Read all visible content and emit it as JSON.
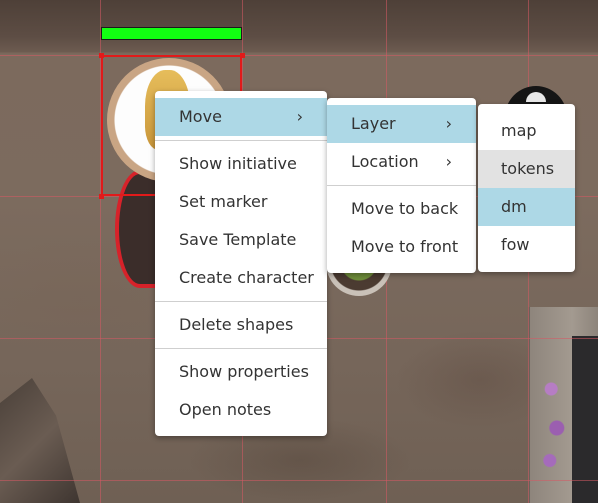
{
  "context_menu": {
    "items": [
      {
        "label": "Move",
        "has_submenu": true
      },
      {
        "label": "Show initiative"
      },
      {
        "label": "Set marker"
      },
      {
        "label": "Save Template"
      },
      {
        "label": "Create character"
      },
      {
        "label": "Delete shapes"
      },
      {
        "label": "Show properties"
      },
      {
        "label": "Open notes"
      }
    ]
  },
  "move_submenu": {
    "items": [
      {
        "label": "Layer",
        "has_submenu": true
      },
      {
        "label": "Location",
        "has_submenu": true
      },
      {
        "label": "Move to back"
      },
      {
        "label": "Move to front"
      }
    ]
  },
  "layer_submenu": {
    "items": [
      {
        "label": "map"
      },
      {
        "label": "tokens"
      },
      {
        "label": "dm"
      },
      {
        "label": "fow"
      }
    ]
  },
  "chevron": "›",
  "token": {
    "health_fraction": 1.0,
    "health_color": "#12ff12"
  },
  "colors": {
    "active_item": "#add8e6",
    "hover_item": "#e2e2e2",
    "selection": "#e11a1a",
    "grid": "#d65a64"
  }
}
